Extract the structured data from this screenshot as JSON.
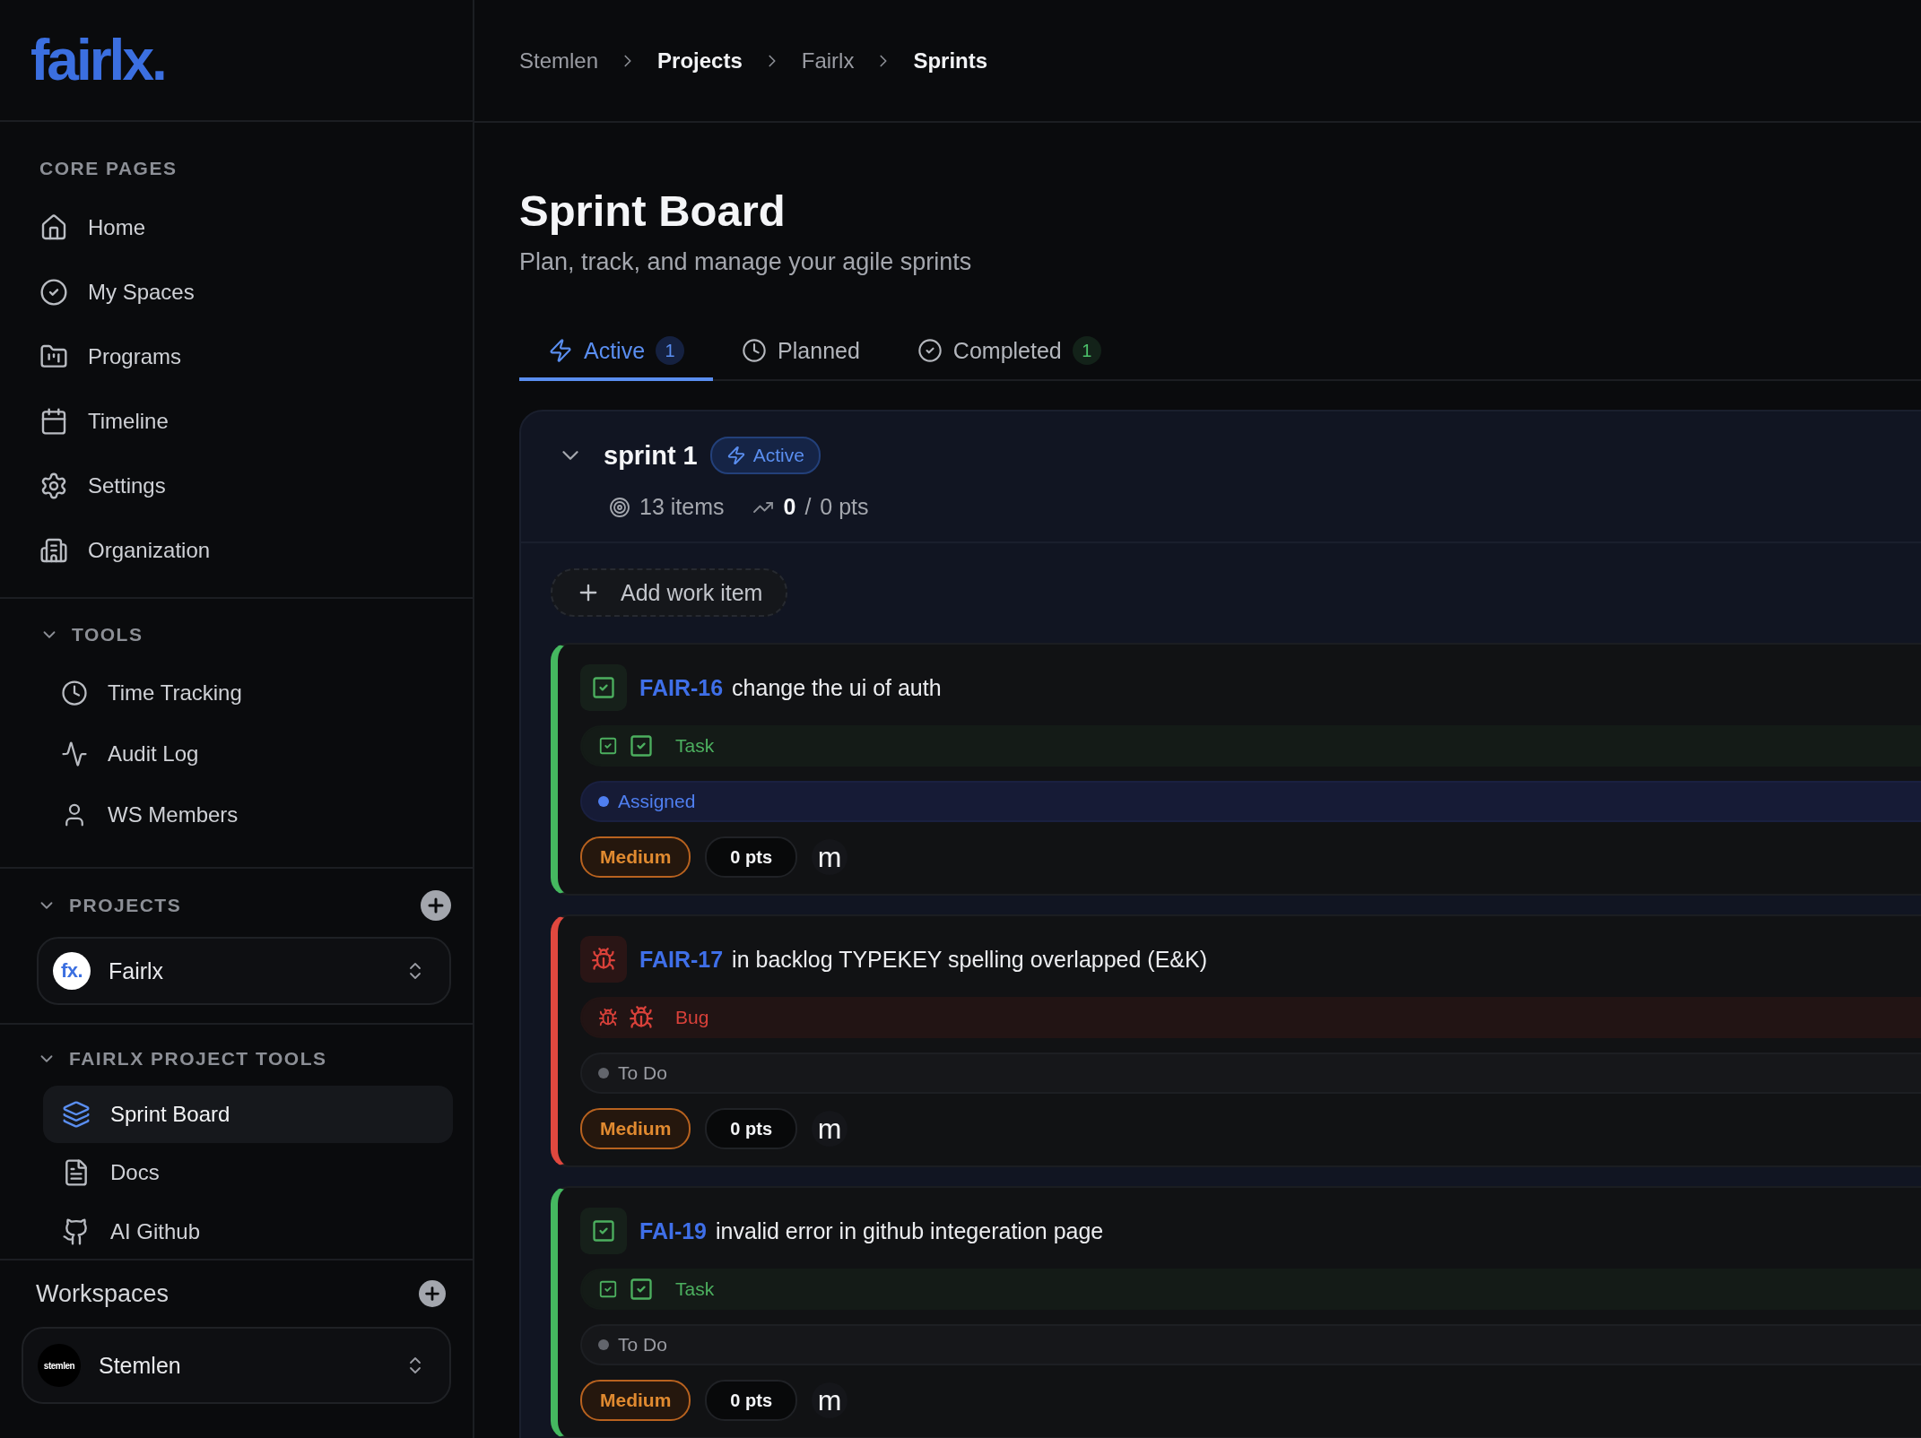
{
  "logo": "fairlx.",
  "core_pages": {
    "heading": "CORE PAGES",
    "items": [
      {
        "label": "Home",
        "selected": false
      },
      {
        "label": "My Spaces",
        "selected": false
      },
      {
        "label": "Programs",
        "selected": false
      },
      {
        "label": "Timeline",
        "selected": false
      },
      {
        "label": "Settings",
        "selected": false
      },
      {
        "label": "Organization",
        "selected": false
      }
    ]
  },
  "tools": {
    "heading": "TOOLS",
    "expanded": true,
    "items": [
      {
        "label": "Time Tracking",
        "selected": false
      },
      {
        "label": "Audit Log",
        "selected": false
      },
      {
        "label": "WS Members",
        "selected": false
      }
    ]
  },
  "projects": {
    "heading": "PROJECTS",
    "expanded": true,
    "project": {
      "avatar": "fx.",
      "name": "Fairlx"
    }
  },
  "project_tools": {
    "heading": "FAIRLX PROJECT TOOLS",
    "expanded": true,
    "items": [
      {
        "label": "Sprint Board",
        "selected": true
      },
      {
        "label": "Docs",
        "selected": false
      },
      {
        "label": "AI Github",
        "selected": false
      }
    ]
  },
  "workspaces": {
    "heading": "Workspaces",
    "workspace": {
      "avatar": "stemlen",
      "name": "Stemlen"
    }
  },
  "breadcrumb": [
    {
      "label": "Stemlen",
      "current": false
    },
    {
      "label": "Projects",
      "current": true
    },
    {
      "label": "Fairlx",
      "current": false
    },
    {
      "label": "Sprints",
      "current": true
    }
  ],
  "page": {
    "title": "Sprint Board",
    "subtitle": "Plan, track, and manage your agile sprints"
  },
  "tabs": [
    {
      "kind": "active",
      "label": "Active",
      "count": "1",
      "selected": true
    },
    {
      "kind": "planned",
      "label": "Planned",
      "selected": false
    },
    {
      "kind": "completed",
      "label": "Completed",
      "count": "1",
      "selected": false
    }
  ],
  "sprint": {
    "name": "sprint 1",
    "expanded": true,
    "status": "Active",
    "items": "13 items",
    "done": "0",
    "separator": "/",
    "total": "0 pts",
    "add_button": "Add work item",
    "work_items": [
      {
        "kind": "task",
        "key": "FAIR-16",
        "title": "change the ui of auth",
        "type": "Task",
        "status": {
          "kind": "assigned",
          "label": "Assigned"
        },
        "priority": "Medium",
        "points": "0 pts",
        "assignee": "m"
      },
      {
        "kind": "bug",
        "key": "FAIR-17",
        "title": "in backlog TYPEKEY spelling overlapped (E&K)",
        "type": "Bug",
        "status": {
          "kind": "todo",
          "label": "To Do"
        },
        "priority": "Medium",
        "points": "0 pts",
        "assignee": "m"
      },
      {
        "kind": "task",
        "key": "FAI-19",
        "title": "invalid error in github integeration page",
        "type": "Task",
        "status": {
          "kind": "todo",
          "label": "To Do"
        },
        "priority": "Medium",
        "points": "0 pts",
        "assignee": "m"
      }
    ]
  }
}
